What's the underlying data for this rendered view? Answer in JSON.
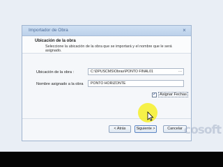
{
  "dialog": {
    "title": "Importador de Obra",
    "close_label": "×",
    "header": {
      "title": "Ubicación de la obra",
      "description": "Seleccione la ubicación de la obra que se importará y el nombre que le será asignado."
    },
    "fields": {
      "location_label": "Ubicación de la obra :",
      "location_value": "C:\\DPUSCMS\\Obras\\PONTO FINAL01",
      "browse_label": "...",
      "name_label": "Nombre asignado a la obra",
      "name_value": "PONTO HORIZONTE"
    },
    "checkbox": {
      "label": "Asignar Fechas",
      "checked": true,
      "mark": "✓"
    },
    "buttons": {
      "back": "< Atrás",
      "next": "Siguiente >",
      "cancel": "Cancelar"
    }
  },
  "watermark": "cosoft",
  "colors": {
    "accent": "#4a6a98",
    "cursor_highlight": "#f6f028"
  }
}
